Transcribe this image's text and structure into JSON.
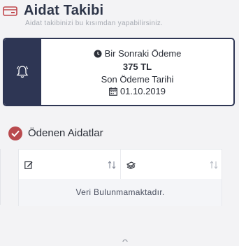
{
  "header": {
    "icon": "wallet-card-icon",
    "title": "Aidat Takibi",
    "subtitle": "Aidat takibinizi bu kısımdan yapabilirsiniz."
  },
  "payment_card": {
    "icon": "bell-icon",
    "next_payment_label": "Bir Sonraki Ödeme",
    "amount": "375 TL",
    "due_date_label": "Son Ödeme Tarihi",
    "due_date": "01.10.2019"
  },
  "paid_section": {
    "title": "Ödenen Aidatlar",
    "columns": [
      {
        "icon": "edit-document-icon",
        "sort_icon": "sort-icon"
      },
      {
        "icon": "money-icon",
        "sort_icon": "sort-icon"
      }
    ],
    "empty_message": "Veri Bulunmamaktadır."
  },
  "colors": {
    "navy": "#2e3654",
    "accent_red": "#b94a4e",
    "background": "#f3f3f5"
  }
}
